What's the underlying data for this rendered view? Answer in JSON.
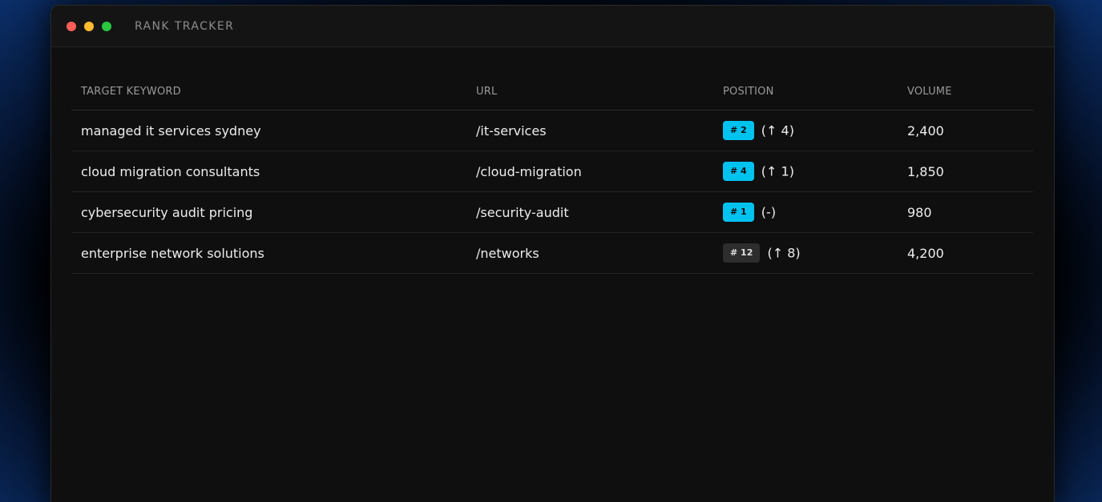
{
  "window": {
    "title": "RANK TRACKER"
  },
  "table": {
    "headers": {
      "keyword": "TARGET KEYWORD",
      "url": "URL",
      "position": "POSITION",
      "volume": "VOLUME"
    },
    "rows": [
      {
        "keyword": "managed it services sydney",
        "url": "/it-services",
        "position": "# 2",
        "change": "(↑ 4)",
        "volume": "2,400"
      },
      {
        "keyword": "cloud migration consultants",
        "url": "/cloud-migration",
        "position": "# 4",
        "change": "(↑ 1)",
        "volume": "1,850"
      },
      {
        "keyword": "cybersecurity audit pricing",
        "url": "/security-audit",
        "position": "# 1",
        "change": "(-)",
        "volume": "980"
      },
      {
        "keyword": "enterprise network solutions",
        "url": "/networks",
        "position": "# 12",
        "change": "(↑ 8)",
        "volume": "4,200"
      }
    ]
  },
  "colors": {
    "badge_top": "#00c2ef",
    "badge_low": "#2d2d2d",
    "window_bg": "#0f0f0f"
  }
}
